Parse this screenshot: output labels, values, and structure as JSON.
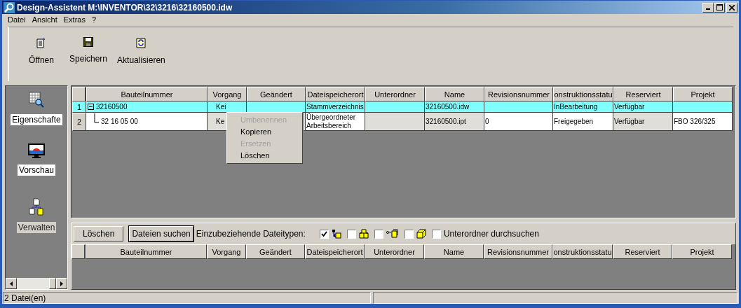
{
  "window": {
    "title": "Design-Assistent M:\\INVENTOR\\32\\3216\\32160500.idw"
  },
  "menu": [
    "Datei",
    "Ansicht",
    "Extras",
    "?"
  ],
  "toolbar": [
    {
      "label": "Öffnen",
      "kind": "open"
    },
    {
      "label": "Speichern",
      "kind": "save"
    },
    {
      "label": "Aktualisieren",
      "kind": "refresh"
    }
  ],
  "sidebar": {
    "items": [
      {
        "label": "Eigenschafte",
        "kind": "properties",
        "selected": false
      },
      {
        "label": "Vorschau",
        "kind": "preview",
        "selected": false
      },
      {
        "label": "Verwalten",
        "kind": "manage",
        "selected": true
      }
    ]
  },
  "table": {
    "columns": [
      {
        "label": "Bauteilnummer",
        "readonly": false
      },
      {
        "label": "Vorgang",
        "readonly": true
      },
      {
        "label": "Geändert",
        "readonly": true
      },
      {
        "label": "Dateispeicherort",
        "readonly": false
      },
      {
        "label": "Unterordner",
        "readonly": true
      },
      {
        "label": "Name",
        "readonly": true
      },
      {
        "label": "Revisionsnummer",
        "readonly": false
      },
      {
        "label": "onstruktionsstatu",
        "readonly": false
      },
      {
        "label": "Reserviert",
        "readonly": true
      },
      {
        "label": "Projekt",
        "readonly": false
      }
    ],
    "rows": [
      {
        "row_number": "1",
        "selected": true,
        "expanded": true,
        "cells": [
          "32160500",
          "Kei",
          "",
          "Stammverzeichnis",
          "",
          "32160500.idw",
          "",
          "InBearbeitung",
          "Verfügbar",
          ""
        ],
        "children": [
          {
            "row_number": "2",
            "selected": false,
            "cells": [
              "32 16 05 00",
              "Ke",
              "",
              "Übergeordneter Arbeitsbereich",
              "",
              "32160500.ipt",
              "0",
              "Freigegeben",
              "Verfügbar",
              "FBO 326/325"
            ]
          }
        ]
      }
    ]
  },
  "context_menu": [
    {
      "label": "Umbenennen",
      "disabled": true
    },
    {
      "label": "Kopieren",
      "disabled": false
    },
    {
      "label": "Ersetzen",
      "disabled": true
    },
    {
      "label": "Löschen",
      "disabled": false
    }
  ],
  "search_panel": {
    "buttons": [
      "Löschen",
      "Dateien suchen"
    ],
    "file_types_label": "Einzubeziehende Dateitypen:",
    "file_types": [
      {
        "kind": "drawing",
        "checked": true
      },
      {
        "kind": "assembly",
        "checked": false
      },
      {
        "kind": "presentation",
        "checked": false
      },
      {
        "kind": "part",
        "checked": false
      }
    ],
    "subfolders": {
      "label": "Unterordner durchsuchen",
      "checked": false
    },
    "columns": [
      "Bauteilnummer",
      "Vorgang",
      "Geändert",
      "Dateispeicherort",
      "Unterordner",
      "Name",
      "Revisionsnummer",
      "onstruktionsstatu",
      "Reserviert",
      "Projekt"
    ]
  },
  "status_bar": {
    "text": "2 Datei(en)"
  }
}
